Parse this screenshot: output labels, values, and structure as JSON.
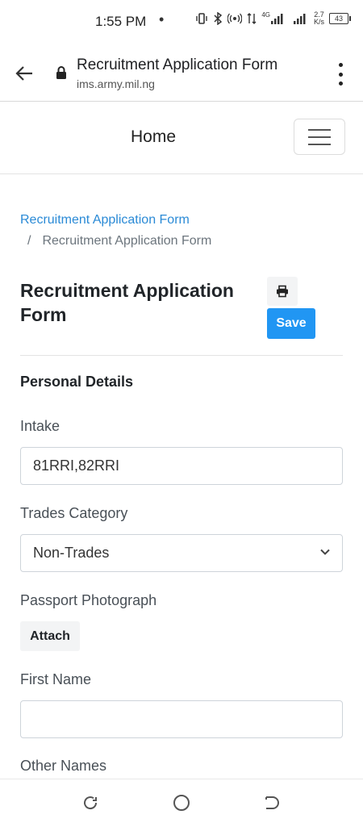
{
  "status_bar": {
    "time": "1:55 PM",
    "dot": "•",
    "network": "4G",
    "speed_value": "2.7",
    "speed_unit": "K/s",
    "battery": "43"
  },
  "browser": {
    "page_title": "Recruitment Application Form",
    "url": "ims.army.mil.ng"
  },
  "navbar": {
    "brand": "Home"
  },
  "breadcrumb": {
    "link": "Recruitment Application Form",
    "separator": "/",
    "current": "Recruitment Application Form"
  },
  "form": {
    "title": "Recruitment Application Form",
    "save_label": "Save",
    "section_title": "Personal Details",
    "fields": {
      "intake": {
        "label": "Intake",
        "value": "81RRI,82RRI"
      },
      "trades_category": {
        "label": "Trades Category",
        "value": "Non-Trades"
      },
      "passport_photo": {
        "label": "Passport Photograph",
        "button": "Attach"
      },
      "first_name": {
        "label": "First Name",
        "value": ""
      },
      "other_names": {
        "label": "Other Names"
      }
    }
  },
  "colors": {
    "primary": "#2196f3",
    "link": "#2a8ad6",
    "muted": "#6c757d",
    "border": "#ced4da"
  }
}
